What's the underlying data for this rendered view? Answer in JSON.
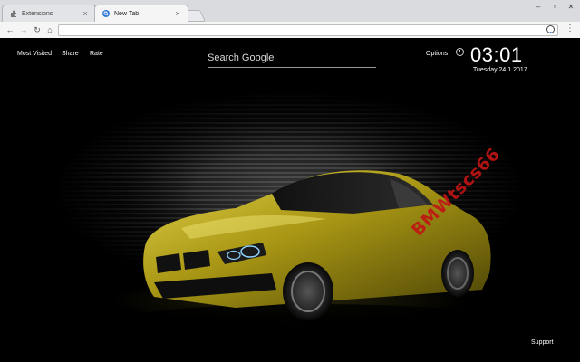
{
  "tabs": [
    {
      "title": "Extensions",
      "favicon": "puzzle-icon",
      "active": false
    },
    {
      "title": "New Tab",
      "favicon": "new-tab-search-icon",
      "active": true
    }
  ],
  "toolbar": {
    "address_value": "",
    "icons": [
      "back-icon",
      "forward-icon",
      "reload-icon",
      "home-icon",
      "extension-logo-icon",
      "menu-icon"
    ]
  },
  "page": {
    "links": {
      "most_visited": "Most Visited",
      "share": "Share",
      "rate": "Rate",
      "options": "Options",
      "support": "Support"
    },
    "search": {
      "placeholder": "Search Google"
    },
    "clock": {
      "time": "03:01",
      "date": "Tuesday  24.1.2017"
    },
    "watermark": "BMWtscs66",
    "accent_colors": {
      "car": "#b8a51a",
      "watermark": "#c21414"
    }
  }
}
